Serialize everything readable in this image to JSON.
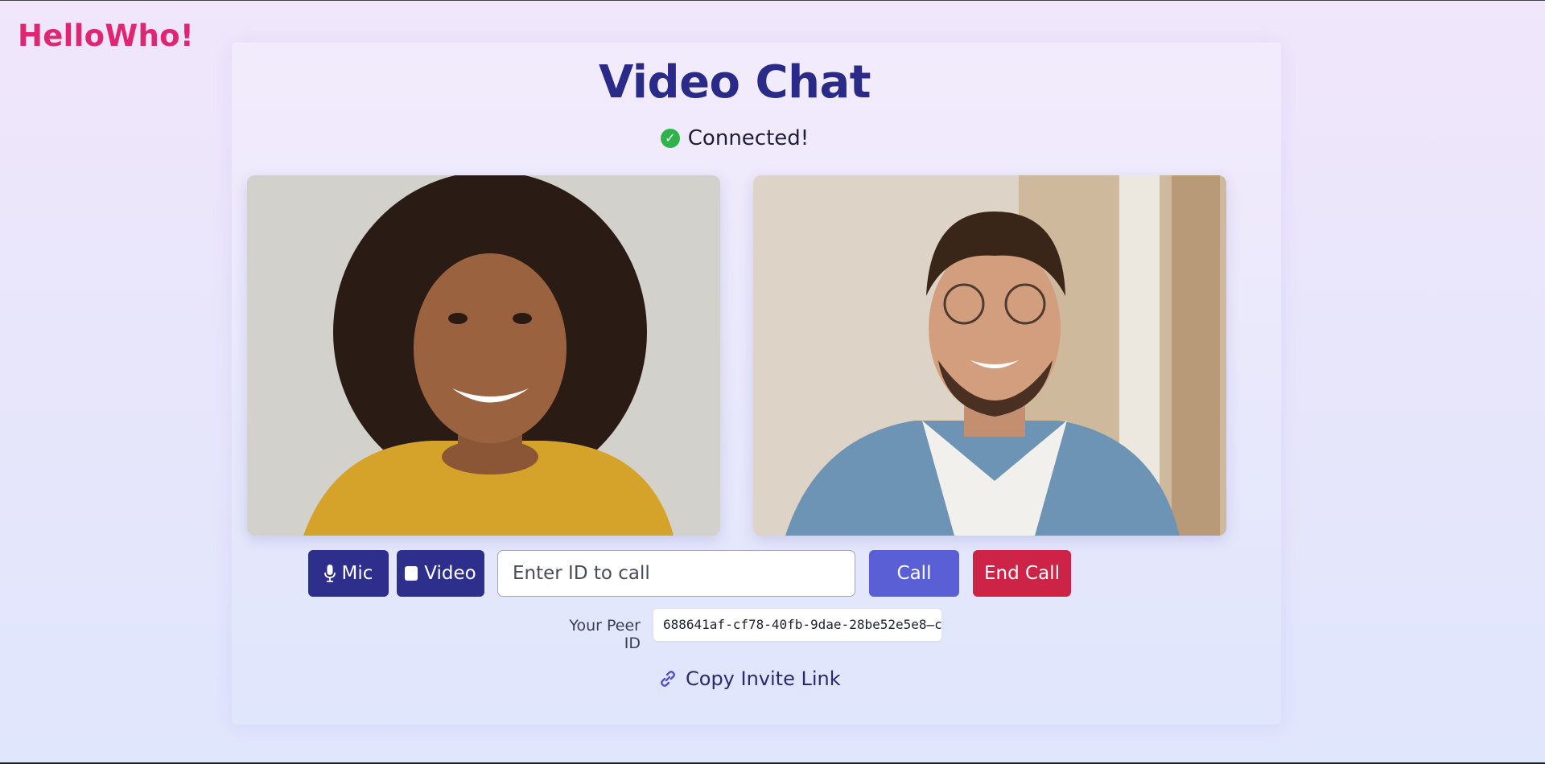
{
  "brand": {
    "name": "HelloWho!"
  },
  "header": {
    "title": "Video Chat"
  },
  "status": {
    "text": "Connected!",
    "icon": "check-circle-icon",
    "color": "#2fb34a"
  },
  "videos": {
    "local": {
      "description_icon": "local-video-feed"
    },
    "remote": {
      "description_icon": "remote-video-feed"
    }
  },
  "controls": {
    "mic_label": "Mic",
    "mic_icon": "microphone-icon",
    "video_label": "Video",
    "video_icon": "video-square-icon",
    "call_input_placeholder": "Enter ID to call",
    "call_input_value": "",
    "call_label": "Call",
    "end_call_label": "End Call"
  },
  "peer": {
    "label": "Your Peer ID",
    "id": "688641af-cf78-40fb-9dae-28be52e5e8̶c"
  },
  "invite": {
    "label": "Copy Invite Link",
    "icon": "link-icon"
  },
  "colors": {
    "brand": "#e02672",
    "title": "#2a2a88",
    "primary_button": "#2e2f8d",
    "call_button": "#5a5fd6",
    "end_button": "#cc2347"
  }
}
